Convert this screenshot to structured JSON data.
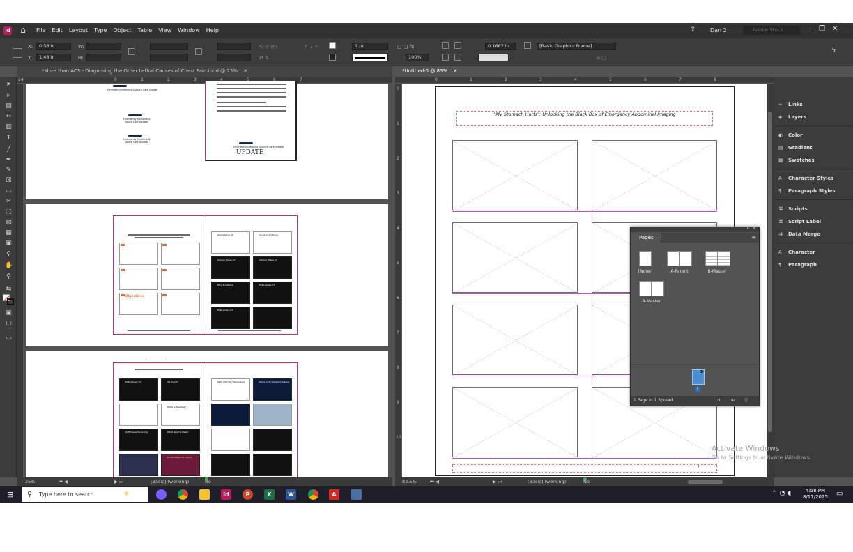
{
  "menubar": {
    "app_logo": "Id",
    "menus": [
      "File",
      "Edit",
      "Layout",
      "Type",
      "Object",
      "Table",
      "View",
      "Window",
      "Help"
    ],
    "user": "Dan 2",
    "search_placeholder": "Adobe Stock",
    "icons": [
      "home-icon",
      "share-icon",
      "search-icon",
      "minimize-icon",
      "restore-icon",
      "close-icon"
    ]
  },
  "control": {
    "x_label": "X:",
    "x_value": "0.56 in",
    "y_label": "Y:",
    "y_value": "1.48 in",
    "w_label": "W:",
    "h_label": "H:",
    "stroke_weight": "1 pt",
    "opacity": "100%",
    "spacing": "0.1667 in",
    "object_style": "[Basic Graphics Frame]"
  },
  "tabs": {
    "left": "*More than ACS - Diagnosing the Other Lethal Causes of Chest Pain.indd @ 25%",
    "right": "*Untitled-5 @ 83%"
  },
  "left_doc": {
    "ruler_h": [
      "24",
      "0",
      "1",
      "2",
      "3",
      "4",
      "5",
      "6",
      "7"
    ],
    "spread1_small_text": [
      "Emergency Medicine & Acute Care Update",
      "Emergency Medicine & Acute Care Update",
      "Emergency Medicine & Acute Care Update"
    ],
    "update_logo": "UPDATE",
    "spread2_slides": [
      "Objectives",
      "Arrive Gone CT",
      "Acute CT Protocol",
      "Venous Phase CT",
      "Arterial Phase CT",
      "Why it matters",
      "Multi-phase CT",
      "Multi-phase CT"
    ],
    "spread3_slides": [
      "Multi-phasic CT",
      "3D Cine CT",
      "Start with the Vasculature",
      "Move on to the Solid Organs",
      "Soft Tissue Stranding",
      "What about a Mass?",
      "What is Bleeding?",
      "Is the Bowel the Culprit?"
    ]
  },
  "status_left": {
    "zoom": "25%",
    "profile": "[Basic] (working)",
    "errors": "No errors"
  },
  "status_right": {
    "zoom": "82.5%",
    "profile": "[Basic] (working)",
    "errors": "No errors"
  },
  "right_doc": {
    "ruler_h": [
      "0",
      "1",
      "2",
      "3",
      "4",
      "5",
      "6",
      "7",
      "8"
    ],
    "ruler_v": [
      "0",
      "1",
      "2",
      "3",
      "4",
      "5",
      "6",
      "7",
      "8",
      "9",
      "10"
    ],
    "title": "\"My Stomach Hurts\": Unlocking the Black Box of Emergency Abdominal Imaging",
    "page_number_marker": "1"
  },
  "panels": [
    {
      "icon": "links-icon",
      "label": "Links"
    },
    {
      "icon": "layers-icon",
      "label": "Layers"
    },
    {
      "icon": "color-icon",
      "label": "Color"
    },
    {
      "icon": "gradient-icon",
      "label": "Gradient"
    },
    {
      "icon": "swatches-icon",
      "label": "Swatches"
    },
    {
      "icon": "character-styles-icon",
      "label": "Character Styles"
    },
    {
      "icon": "paragraph-styles-icon",
      "label": "Paragraph Styles"
    },
    {
      "icon": "scripts-icon",
      "label": "Scripts"
    },
    {
      "icon": "script-label-icon",
      "label": "Script Label"
    },
    {
      "icon": "data-merge-icon",
      "label": "Data Merge"
    },
    {
      "icon": "character-icon",
      "label": "Character"
    },
    {
      "icon": "paragraph-icon",
      "label": "Paragraph"
    }
  ],
  "pages_panel": {
    "title": "Pages",
    "masters": [
      "[None]",
      "A-Parent",
      "B-Master",
      "A-Master"
    ],
    "page_prefix": "B",
    "page_number": "1",
    "footer": "1 Page in 1 Spread"
  },
  "activate": {
    "line1": "Activate Windows",
    "line2": "Go to Settings to activate Windows."
  },
  "taskbar": {
    "search": "Type here to search",
    "time": "4:58 PM",
    "date": "8/17/2025",
    "apps": [
      {
        "name": "copilot-icon",
        "color": "#7b5cff"
      },
      {
        "name": "chrome-icon",
        "color": "#e0a100"
      },
      {
        "name": "file-explorer-icon",
        "color": "#f2c230"
      },
      {
        "name": "indesign-icon",
        "color": "#c2185b",
        "label": "Id"
      },
      {
        "name": "powerpoint-icon",
        "color": "#d24726",
        "label": "P"
      },
      {
        "name": "excel-icon",
        "color": "#1d6f42",
        "label": "X"
      },
      {
        "name": "word-icon",
        "color": "#2b579a",
        "label": "W"
      },
      {
        "name": "chrome-profile-icon",
        "color": "#db4437"
      },
      {
        "name": "acrobat-icon",
        "color": "#d9261c",
        "label": "A"
      },
      {
        "name": "calculator-icon",
        "color": "#4a6fa5"
      }
    ]
  }
}
